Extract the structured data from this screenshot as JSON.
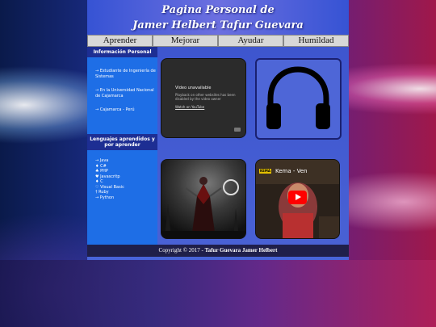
{
  "header": {
    "line1": "Pagina Personal de",
    "line2": "Jamer Helbert Tafur Guevara"
  },
  "nav": {
    "tabs": [
      "Aprender",
      "Mejorar",
      "Ayudar",
      "Humildad"
    ]
  },
  "sidebar": {
    "info_title": "Información Personal",
    "info_items": [
      "→ Estudiante de Ingeniería de Sistemas",
      "→ En la Universidad Nacional de Cajamarca",
      "→ Cajamarca - Perú"
    ],
    "lang_title": "Lenguajes aprendidos y por aprender",
    "lang_items": [
      "→ Java",
      "♦ C#",
      "♣ PHP",
      "♥ Javascritp",
      "♦ C",
      "♡ Visual Basic",
      "† Ruby",
      "→ Python"
    ]
  },
  "video": {
    "title": "Video unavailable",
    "message": "Playback on other websites has been disabled by the video owner",
    "link": "Watch on YouTube"
  },
  "youtube": {
    "channel_badge": "KEMA",
    "title": "Kema - Ven"
  },
  "footer": {
    "prefix": "Copyright © 2017 - ",
    "author": "Tafur Guevara Jamer Helbert"
  },
  "icons": [
    "headphones-icon",
    "play-button-icon",
    "youtube-logo-icon"
  ]
}
